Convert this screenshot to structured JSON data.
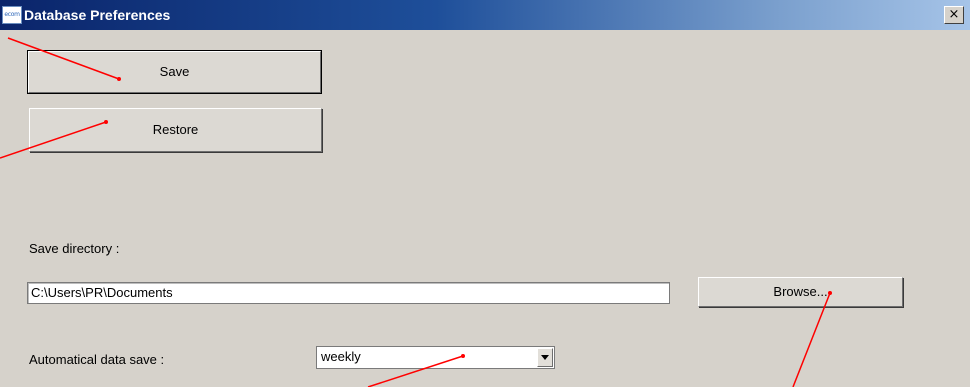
{
  "window": {
    "title": "Database Preferences",
    "icon_text": "ecom",
    "close_glyph": "×"
  },
  "buttons": {
    "save": "Save",
    "restore": "Restore",
    "browse": "Browse..."
  },
  "directory": {
    "label": "Save directory :",
    "value": "C:\\Users\\PR\\Documents"
  },
  "autosave": {
    "label": "Automatical data save :",
    "selected": "weekly"
  },
  "colors": {
    "window_bg": "#d6d2cb",
    "title_gradient_start": "#0a246a",
    "title_gradient_end": "#a6c4e8",
    "annotation_line": "#ff0000"
  }
}
